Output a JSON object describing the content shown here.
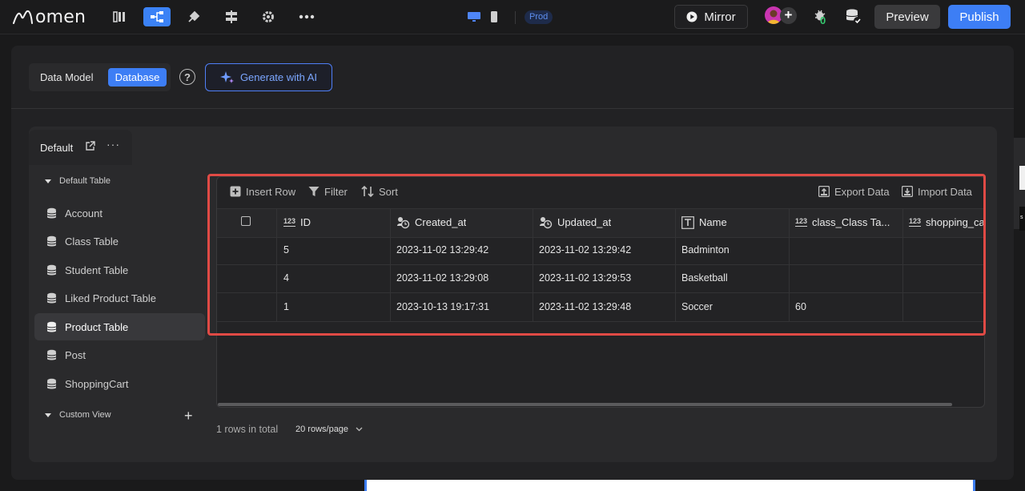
{
  "topbar": {
    "logo_text": "omen",
    "prod_badge": "Prod",
    "mirror_label": "Mirror",
    "bug_count": "0",
    "preview_label": "Preview",
    "publish_label": "Publish"
  },
  "header": {
    "data_model_label": "Data Model",
    "database_label": "Database",
    "help_glyph": "?",
    "ai_button_label": "Generate with AI"
  },
  "tab": {
    "label": "Default",
    "more": "···"
  },
  "sidebar": {
    "default_group": "Default Table",
    "items": [
      {
        "label": "Account"
      },
      {
        "label": "Class Table"
      },
      {
        "label": "Student Table"
      },
      {
        "label": "Liked Product Table"
      },
      {
        "label": "Product Table"
      },
      {
        "label": "Post"
      },
      {
        "label": "ShoppingCart"
      }
    ],
    "custom_group": "Custom View",
    "add_glyph": "+"
  },
  "toolbar": {
    "insert_row": "Insert Row",
    "filter": "Filter",
    "sort": "Sort",
    "export": "Export Data",
    "import": "Import Data"
  },
  "table": {
    "type_badge": "123",
    "columns": [
      "ID",
      "Created_at",
      "Updated_at",
      "Name",
      "class_Class Ta...",
      "shopping_ca"
    ],
    "rows": [
      [
        "5",
        "2023-11-02 13:29:42",
        "2023-11-02 13:29:42",
        "Badminton",
        "",
        ""
      ],
      [
        "4",
        "2023-11-02 13:29:08",
        "2023-11-02 13:29:53",
        "Basketball",
        "",
        ""
      ],
      [
        "1",
        "2023-10-13 19:17:31",
        "2023-11-02 13:29:48",
        "Soccer",
        "60",
        ""
      ]
    ]
  },
  "footer": {
    "total": "1 rows in total",
    "page_size": "20 rows/page"
  },
  "edge": {
    "text": "s"
  },
  "colors": {
    "accent": "#3d7ef5",
    "highlight": "#e04a45",
    "background": "#1a1a1b"
  }
}
